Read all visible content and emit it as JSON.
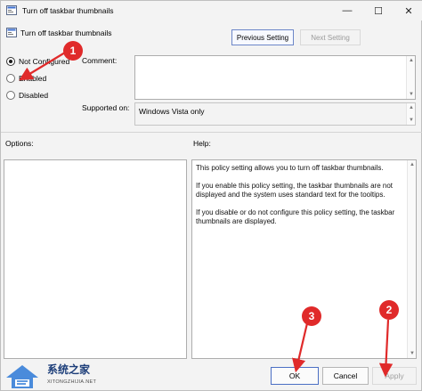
{
  "window": {
    "title": "Turn off taskbar thumbnails",
    "controls": {
      "minimize": "—",
      "maximize": "☐",
      "close": "✕"
    }
  },
  "header": {
    "policy_title": "Turn off taskbar thumbnails",
    "previous_setting": "Previous Setting",
    "next_setting": "Next Setting"
  },
  "options": {
    "not_configured": "Not Configured",
    "enabled": "Enabled",
    "disabled": "Disabled",
    "selected": "not_configured"
  },
  "comment": {
    "label": "Comment:",
    "value": ""
  },
  "supported_on": {
    "label": "Supported on:",
    "value": "Windows Vista only"
  },
  "panels": {
    "options_label": "Options:",
    "help_label": "Help:"
  },
  "help": {
    "paragraphs": [
      "This policy setting allows you to turn off taskbar thumbnails.",
      "If you enable this policy setting, the taskbar thumbnails are not displayed and the system uses standard text for the tooltips.",
      "If you disable or do not configure this policy setting, the taskbar thumbnails are displayed."
    ]
  },
  "footer": {
    "ok": "OK",
    "cancel": "Cancel",
    "apply": "Apply"
  },
  "annotations": {
    "badge_1": "1",
    "badge_2": "2",
    "badge_3": "3",
    "color": "#e02a2a"
  },
  "watermark": {
    "text": "系统之家",
    "url": "XITONGZHIJIA.NET"
  }
}
